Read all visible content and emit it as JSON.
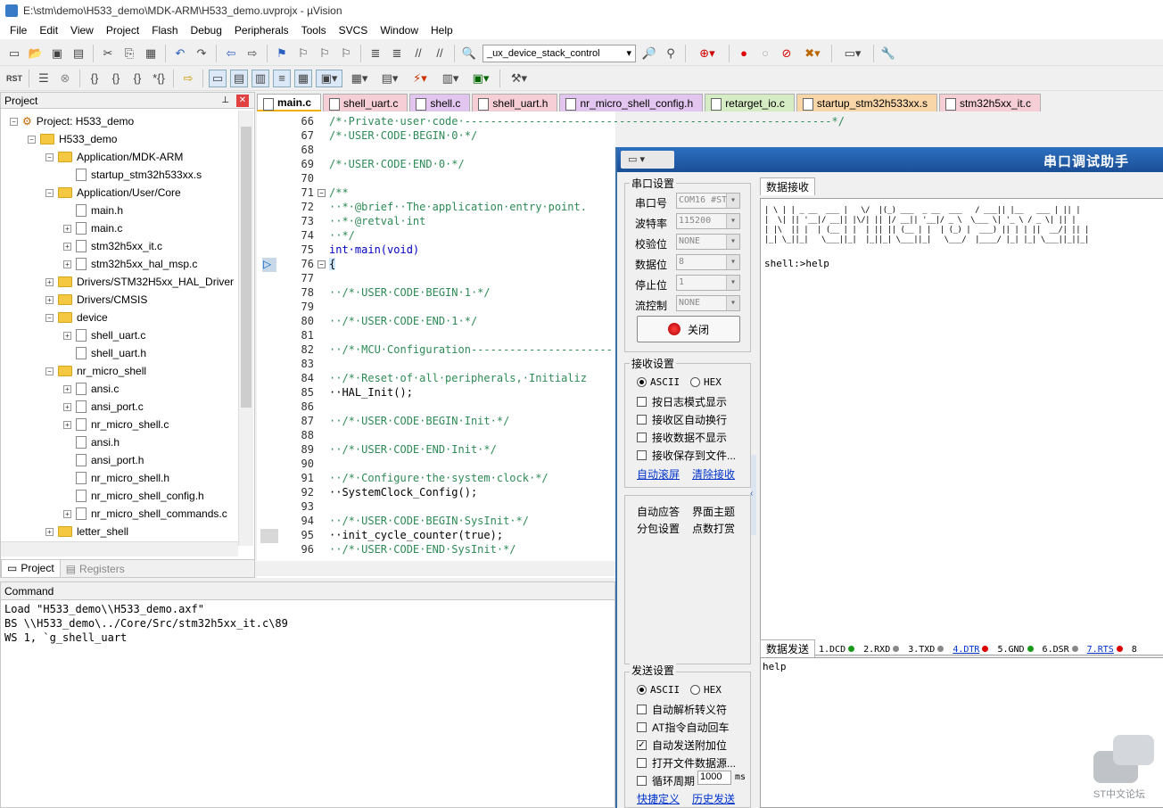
{
  "window": {
    "title": "E:\\stm\\demo\\H533_demo\\MDK-ARM\\H533_demo.uvprojx - µVision"
  },
  "menu": [
    "File",
    "Edit",
    "View",
    "Project",
    "Flash",
    "Debug",
    "Peripherals",
    "Tools",
    "SVCS",
    "Window",
    "Help"
  ],
  "toolbar": {
    "target_combo": "_ux_device_stack_control"
  },
  "project": {
    "header": "Project",
    "tree": [
      {
        "label": "Project: H533_demo",
        "type": "root",
        "depth": 0
      },
      {
        "label": "H533_demo",
        "type": "folder",
        "depth": 1
      },
      {
        "label": "Application/MDK-ARM",
        "type": "folder",
        "depth": 2
      },
      {
        "label": "startup_stm32h533xx.s",
        "type": "file",
        "depth": 3
      },
      {
        "label": "Application/User/Core",
        "type": "folder",
        "depth": 2
      },
      {
        "label": "main.h",
        "type": "file",
        "depth": 3
      },
      {
        "label": "main.c",
        "type": "file",
        "depth": 3
      },
      {
        "label": "stm32h5xx_it.c",
        "type": "file",
        "depth": 3
      },
      {
        "label": "stm32h5xx_hal_msp.c",
        "type": "file",
        "depth": 3
      },
      {
        "label": "Drivers/STM32H5xx_HAL_Driver",
        "type": "folder",
        "depth": 2
      },
      {
        "label": "Drivers/CMSIS",
        "type": "folder",
        "depth": 2
      },
      {
        "label": "device",
        "type": "folder",
        "depth": 2
      },
      {
        "label": "shell_uart.c",
        "type": "file",
        "depth": 3
      },
      {
        "label": "shell_uart.h",
        "type": "file",
        "depth": 3
      },
      {
        "label": "nr_micro_shell",
        "type": "folder",
        "depth": 2
      },
      {
        "label": "ansi.c",
        "type": "file",
        "depth": 3
      },
      {
        "label": "ansi_port.c",
        "type": "file",
        "depth": 3
      },
      {
        "label": "nr_micro_shell.c",
        "type": "file",
        "depth": 3
      },
      {
        "label": "ansi.h",
        "type": "file",
        "depth": 3
      },
      {
        "label": "ansi_port.h",
        "type": "file",
        "depth": 3
      },
      {
        "label": "nr_micro_shell.h",
        "type": "file",
        "depth": 3
      },
      {
        "label": "nr_micro_shell_config.h",
        "type": "file",
        "depth": 3
      },
      {
        "label": "nr_micro_shell_commands.c",
        "type": "file",
        "depth": 3
      },
      {
        "label": "letter_shell",
        "type": "folder",
        "depth": 2
      }
    ],
    "tabs": [
      "Project",
      "Registers"
    ]
  },
  "editor": {
    "tabs": [
      {
        "label": "main.c",
        "color": "#ffffff"
      },
      {
        "label": "shell_uart.c",
        "color": "#f6cfd6"
      },
      {
        "label": "shell.c",
        "color": "#e2c6ef"
      },
      {
        "label": "shell_uart.h",
        "color": "#f6cfd6"
      },
      {
        "label": "nr_micro_shell_config.h",
        "color": "#e2c6ef"
      },
      {
        "label": "retarget_io.c",
        "color": "#d6ecc4"
      },
      {
        "label": "startup_stm32h533xx.s",
        "color": "#f8d6a8"
      },
      {
        "label": "stm32h5xx_it.c",
        "color": "#f6cfd6"
      }
    ],
    "lines": [
      {
        "n": "66",
        "t": "/*·Private·user·code·---------------------------------------------------------*/",
        "c": "cm"
      },
      {
        "n": "67",
        "t": "/*·USER·CODE·BEGIN·0·*/",
        "c": "cm"
      },
      {
        "n": "68",
        "t": "",
        "c": ""
      },
      {
        "n": "69",
        "t": "/*·USER·CODE·END·0·*/",
        "c": "cm"
      },
      {
        "n": "70",
        "t": "",
        "c": ""
      },
      {
        "n": "71",
        "t": "/**",
        "c": "cm"
      },
      {
        "n": "72",
        "t": "··*·@brief··The·application·entry·point.",
        "c": "cm"
      },
      {
        "n": "73",
        "t": "··*·@retval·int",
        "c": "cm"
      },
      {
        "n": "74",
        "t": "··*/",
        "c": "cm"
      },
      {
        "n": "75",
        "t": "int·main(void)",
        "c": "kw"
      },
      {
        "n": "76",
        "t": "{",
        "c": ""
      },
      {
        "n": "77",
        "t": "",
        "c": ""
      },
      {
        "n": "78",
        "t": "··/*·USER·CODE·BEGIN·1·*/",
        "c": "cm"
      },
      {
        "n": "79",
        "t": "",
        "c": ""
      },
      {
        "n": "80",
        "t": "··/*·USER·CODE·END·1·*/",
        "c": "cm"
      },
      {
        "n": "81",
        "t": "",
        "c": ""
      },
      {
        "n": "82",
        "t": "··/*·MCU·Configuration----------------------",
        "c": "cm"
      },
      {
        "n": "83",
        "t": "",
        "c": ""
      },
      {
        "n": "84",
        "t": "··/*·Reset·of·all·peripherals,·Initializ",
        "c": "cm"
      },
      {
        "n": "85",
        "t": "··HAL_Init();",
        "c": ""
      },
      {
        "n": "86",
        "t": "",
        "c": ""
      },
      {
        "n": "87",
        "t": "··/*·USER·CODE·BEGIN·Init·*/",
        "c": "cm"
      },
      {
        "n": "88",
        "t": "",
        "c": ""
      },
      {
        "n": "89",
        "t": "··/*·USER·CODE·END·Init·*/",
        "c": "cm"
      },
      {
        "n": "90",
        "t": "",
        "c": ""
      },
      {
        "n": "91",
        "t": "··/*·Configure·the·system·clock·*/",
        "c": "cm"
      },
      {
        "n": "92",
        "t": "··SystemClock_Config();",
        "c": ""
      },
      {
        "n": "93",
        "t": "",
        "c": ""
      },
      {
        "n": "94",
        "t": "··/*·USER·CODE·BEGIN·SysInit·*/",
        "c": "cm"
      },
      {
        "n": "95",
        "t": "··init_cycle_counter(true);",
        "c": ""
      },
      {
        "n": "96",
        "t": "··/*·USER·CODE·END·SysInit·*/",
        "c": "cm"
      }
    ]
  },
  "command": {
    "header": "Command",
    "lines": [
      "Load \"H533_demo\\\\H533_demo.axf\"",
      "BS \\\\H533_demo\\../Core/Src/stm32h5xx_it.c\\89",
      "WS 1, `g_shell_uart"
    ]
  },
  "serial": {
    "title": "串口调试助手",
    "port_group": "串口设置",
    "port_label": "串口号",
    "port_value": "COM16 #ST",
    "baud_label": "波特率",
    "baud_value": "115200",
    "parity_label": "校验位",
    "parity_value": "NONE",
    "databits_label": "数据位",
    "databits_value": "8",
    "stopbits_label": "停止位",
    "stopbits_value": "1",
    "flow_label": "流控制",
    "flow_value": "NONE",
    "close_button": "关闭",
    "rx_group": "接收设置",
    "ascii": "ASCII",
    "hex": "HEX",
    "rx_opts": [
      "按日志模式显示",
      "接收区自动换行",
      "接收数据不显示",
      "接收保存到文件..."
    ],
    "auto_scroll": "自动滚屏",
    "clear_rx": "清除接收",
    "auto_reply": "自动应答",
    "theme": "界面主题",
    "split": "分包设置",
    "dot_print": "点数打赏",
    "tx_group": "发送设置",
    "tx_opts": [
      "自动解析转义符",
      "AT指令自动回车",
      "自动发送附加位",
      "打开文件数据源...",
      "循环周期"
    ],
    "tx_checked": [
      false,
      false,
      true,
      false,
      false
    ],
    "period_value": "1000",
    "period_unit": "ms",
    "shortcut": "快捷定义",
    "history": "历史发送",
    "rx_tab": "数据接收",
    "rx_prompt": "shell:>help",
    "tx_tab": "数据发送",
    "signals": [
      "1.DCD",
      "2.RXD",
      "3.TXD",
      "4.DTR",
      "5.GND",
      "6.DSR",
      "7.RTS",
      "8"
    ],
    "tx_text": "help",
    "banner": [
      "| \\ | | _ __  ___ |   \\/  |(_) ___  _ __  ___   / ___|| |__   ___ | || |",
      "|  \\| || '__|/ __|| |\\/| || |/ __|| '__|/ _ \\  \\___ \\| '_ \\ / _ \\| || |",
      "| |\\  || |  | (__ | |  | || || (__ | |  | (_) |  ___) || | | ||  __/| || |",
      "|_| \\_||_|   \\___||_|  |_||_| \\___||_|   \\___/  |____/ |_| |_| \\___||_||_|"
    ]
  },
  "watermark": {
    "text": "ST中文论坛"
  }
}
